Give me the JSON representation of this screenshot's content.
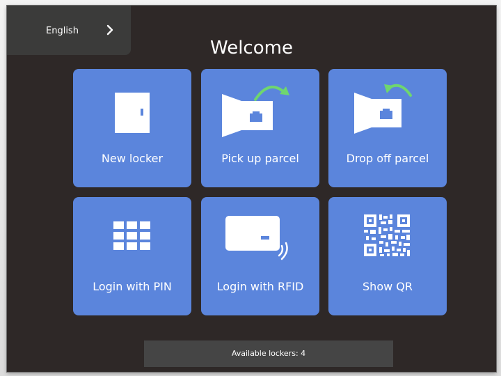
{
  "language": {
    "label": "English"
  },
  "title": "Welcome",
  "tiles": [
    {
      "label": "New locker",
      "icon": "locker-door-icon"
    },
    {
      "label": "Pick up parcel",
      "icon": "pickup-parcel-icon"
    },
    {
      "label": "Drop off parcel",
      "icon": "dropoff-parcel-icon"
    },
    {
      "label": "Login with PIN",
      "icon": "keypad-icon"
    },
    {
      "label": "Login with RFID",
      "icon": "rfid-card-icon"
    },
    {
      "label": "Show QR",
      "icon": "qr-code-icon"
    }
  ],
  "footer": {
    "text": "Available lockers: 4"
  },
  "colors": {
    "background": "#2e2827",
    "tile": "#5b85dc",
    "arrow": "#6fd66f",
    "language_bar": "#3b3b3a",
    "footer": "#454545"
  }
}
